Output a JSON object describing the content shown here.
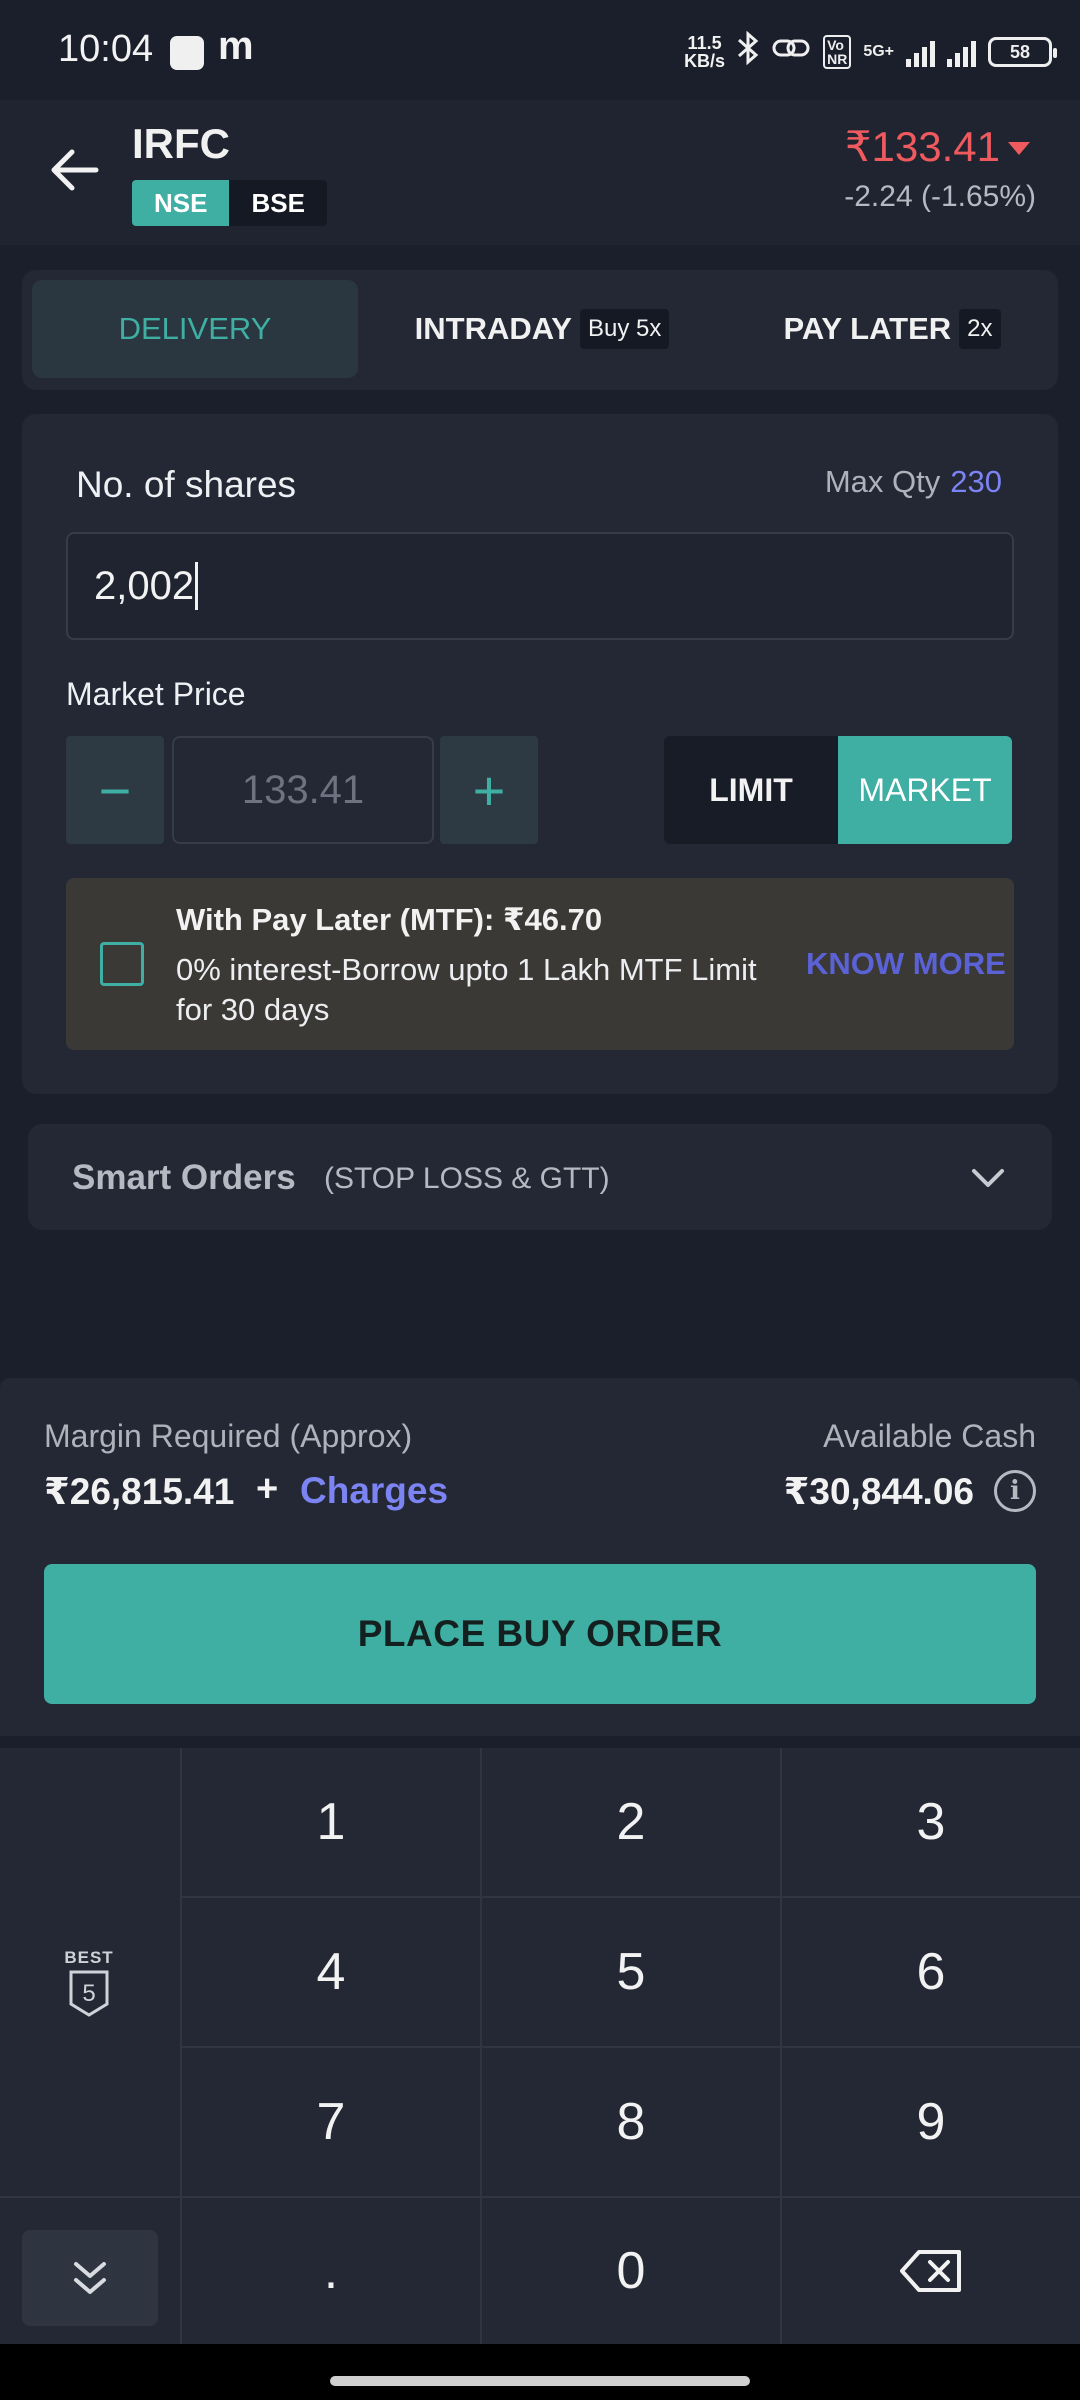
{
  "status_bar": {
    "time": "10:04",
    "speed_value": "11.5",
    "speed_unit": "KB/s",
    "network": "5G+",
    "battery": "58"
  },
  "header": {
    "symbol": "IRFC",
    "exchanges": [
      "NSE",
      "BSE"
    ],
    "selected_exchange": "NSE",
    "price": "₹133.41",
    "change": "-2.24 (-1.65%)",
    "price_color": "#ef5a5f"
  },
  "product_tabs": {
    "delivery": "DELIVERY",
    "intraday": "INTRADAY",
    "intraday_tag": "Buy 5x",
    "pay_later": "PAY LATER",
    "pay_later_tag": "2x"
  },
  "order_form": {
    "shares_label": "No. of shares",
    "max_qty_label": "Max Qty",
    "max_qty_value": "230",
    "quantity": "2,002",
    "price_label": "Market Price",
    "price_value": "133.41",
    "minus": "−",
    "plus": "+",
    "limit_label": "LIMIT",
    "market_label": "MARKET",
    "selected_order_type": "MARKET"
  },
  "mtf": {
    "title": "With Pay Later (MTF): ₹46.70",
    "description": "0% interest-Borrow upto 1 Lakh MTF Limit for 30 days",
    "know_more": "KNOW MORE",
    "checked": false
  },
  "smart_orders": {
    "title": "Smart Orders",
    "subtitle": "(STOP LOSS & GTT)"
  },
  "summary": {
    "margin_label": "Margin Required (Approx)",
    "margin_value": "₹26,815.41",
    "plus": "+",
    "charges_label": "Charges",
    "cash_label": "Available Cash",
    "cash_value": "₹30,844.06",
    "info_glyph": "i",
    "buy_button": "PLACE BUY ORDER"
  },
  "keypad": {
    "keys": [
      "1",
      "2",
      "3",
      "4",
      "5",
      "6",
      "7",
      "8",
      "9",
      ".",
      "0"
    ],
    "best_label": "BEST",
    "best_number": "5"
  },
  "accent_color": "#3faea3",
  "link_color": "#7c84f4"
}
